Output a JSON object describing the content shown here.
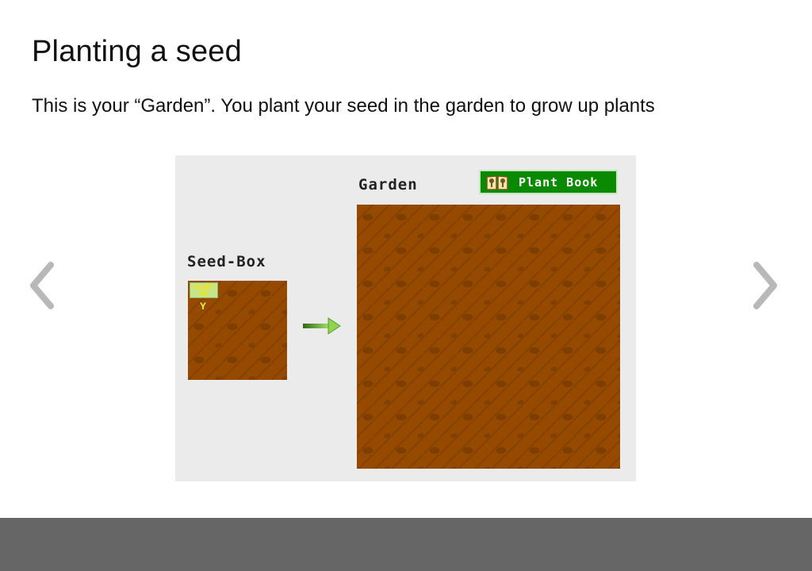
{
  "page": {
    "title": "Planting a seed",
    "subtitle": "This is your “Garden”. You plant your seed in the garden to grow up plants"
  },
  "carousel": {
    "prev_icon": "chevron-left-icon",
    "next_icon": "chevron-right-icon"
  },
  "game": {
    "garden_label": "Garden",
    "seedbox_label": "Seed-Box",
    "plant_book_label": "Plant Book",
    "plant_book_icon": "book-icon",
    "seed_packet_text": "PLANT ME",
    "sprout_glyph": "Y",
    "colors": {
      "dirt": "#964a00",
      "panel": "#ebebeb",
      "button": "#0a8a00",
      "arrow": "#6fbf2a"
    }
  },
  "footer": {
    "color": "#666666"
  }
}
